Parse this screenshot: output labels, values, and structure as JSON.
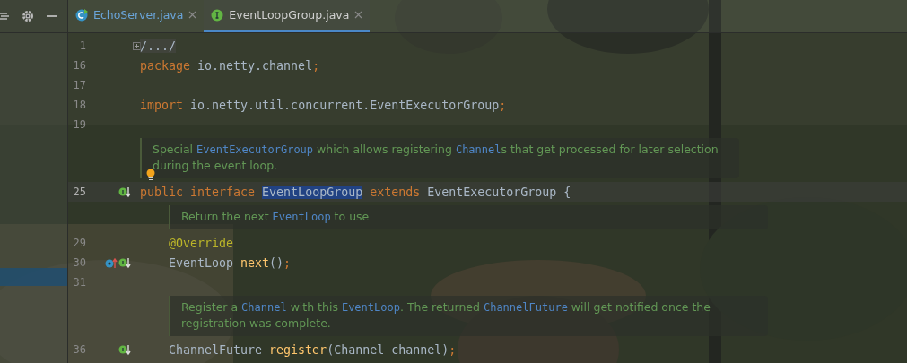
{
  "tabs": [
    {
      "label": "EchoServer.java",
      "kind": "class",
      "selected": false
    },
    {
      "label": "EventLoopGroup.java",
      "kind": "interface",
      "selected": true
    }
  ],
  "lines": [
    {
      "kind": "code",
      "number": "1",
      "fold": true,
      "tokens": [
        {
          "t": "/.../",
          "kind": "folded"
        }
      ]
    },
    {
      "kind": "code",
      "number": "16",
      "tokens": [
        {
          "t": "package ",
          "kind": "keyword"
        },
        {
          "t": "io.netty.channel",
          "kind": "plain"
        },
        {
          "t": ";",
          "kind": "punct"
        }
      ]
    },
    {
      "kind": "code",
      "number": "17"
    },
    {
      "kind": "code",
      "number": "18",
      "tokens": [
        {
          "t": "import ",
          "kind": "keyword"
        },
        {
          "t": "io.netty.util.concurrent.EventExecutorGroup",
          "kind": "plain"
        },
        {
          "t": ";",
          "kind": "punct"
        }
      ]
    },
    {
      "kind": "code",
      "number": "19"
    },
    {
      "kind": "doc",
      "bulb": true,
      "parts": [
        {
          "t": "Special ",
          "kind": "text"
        },
        {
          "t": "EventExecutorGroup",
          "kind": "ref"
        },
        {
          "t": " which allows registering ",
          "kind": "text"
        },
        {
          "t": "Channel",
          "kind": "ref"
        },
        {
          "t": "s that get processed for later selection during the event loop.",
          "kind": "text"
        }
      ]
    },
    {
      "kind": "code",
      "number": "25",
      "current": true,
      "markers": [
        {
          "kind": "implemented"
        }
      ],
      "tokens": [
        {
          "t": "public interface ",
          "kind": "keyword"
        },
        {
          "t": "EventLoopGroup",
          "kind": "highlight"
        },
        {
          "t": " extends ",
          "kind": "keyword"
        },
        {
          "t": "EventExecutorGroup {",
          "kind": "plain"
        }
      ],
      "children": [
        {
          "kind": "doc",
          "parts": [
            {
              "t": "Return the next ",
              "kind": "text"
            },
            {
              "t": "EventLoop",
              "kind": "ref"
            },
            {
              "t": " to use",
              "kind": "text"
            }
          ]
        },
        {
          "kind": "code",
          "number": "29",
          "tokens": [
            {
              "t": "@Override",
              "kind": "annotation"
            }
          ]
        },
        {
          "kind": "code",
          "number": "30",
          "markers": [
            {
              "kind": "overrides"
            },
            {
              "kind": "implemented"
            }
          ],
          "tokens": [
            {
              "t": "EventLoop ",
              "kind": "plain"
            },
            {
              "t": "next",
              "kind": "method"
            },
            {
              "t": "()",
              "kind": "plain"
            },
            {
              "t": ";",
              "kind": "punct"
            }
          ]
        },
        {
          "kind": "code",
          "number": "31"
        },
        {
          "kind": "doc",
          "parts": [
            {
              "t": "Register a ",
              "kind": "text"
            },
            {
              "t": "Channel",
              "kind": "ref"
            },
            {
              "t": " with this ",
              "kind": "text"
            },
            {
              "t": "EventLoop",
              "kind": "ref"
            },
            {
              "t": ". The returned ",
              "kind": "text"
            },
            {
              "t": "ChannelFuture",
              "kind": "ref"
            },
            {
              "t": " will get notified once the registration was complete.",
              "kind": "text"
            }
          ]
        },
        {
          "kind": "code",
          "number": "36",
          "markers": [
            {
              "kind": "implemented"
            }
          ],
          "tokens": [
            {
              "t": "ChannelFuture ",
              "kind": "plain"
            },
            {
              "t": "register",
              "kind": "method"
            },
            {
              "t": "(Channel channel)",
              "kind": "plain"
            },
            {
              "t": ";",
              "kind": "punct"
            }
          ]
        }
      ]
    }
  ]
}
